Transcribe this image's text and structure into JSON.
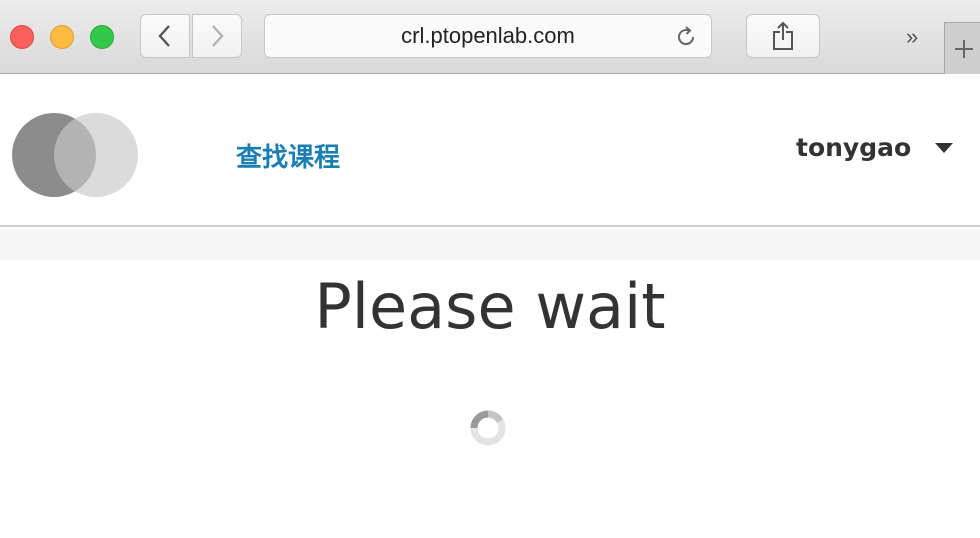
{
  "browser": {
    "url": "crl.ptopenlab.com",
    "icons": {
      "back": "chevron-left-icon",
      "forward": "chevron-right-icon",
      "reload": "reload-icon",
      "share": "share-icon",
      "overflow": "double-chevron-right-icon",
      "new_tab": "plus-icon"
    },
    "overflow_label": "»"
  },
  "header": {
    "nav_link": "查找课程",
    "username": "tonygao"
  },
  "main": {
    "title": "Please wait"
  },
  "colors": {
    "link": "#1a7fb0",
    "text": "#333333",
    "close": "#fc605c",
    "minimize": "#fdbc40",
    "maximize": "#34c84a"
  }
}
